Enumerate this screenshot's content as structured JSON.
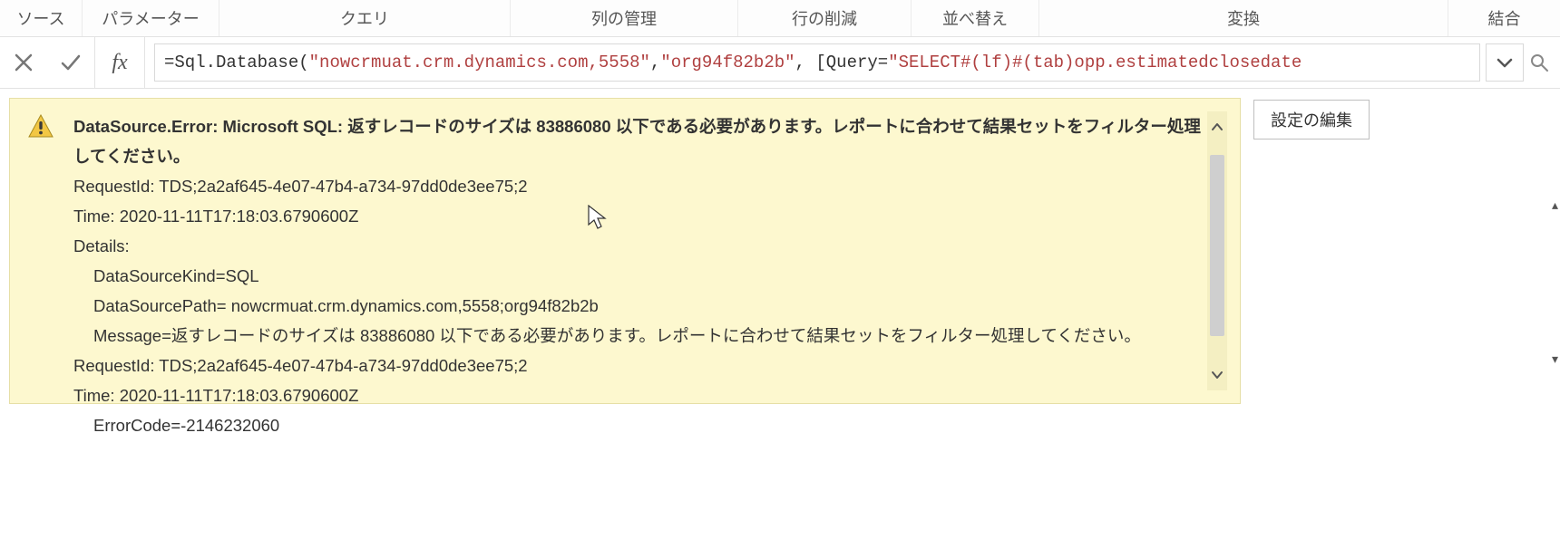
{
  "ribbon": {
    "source": "ソース",
    "param": "パラメーター",
    "query": "クエリ",
    "manage": "列の管理",
    "reduce": "行の削減",
    "sort": "並べ替え",
    "transform": "変換",
    "combine": "結合"
  },
  "formula": {
    "prefix": "= ",
    "fn": "Sql.Database",
    "open": "(",
    "arg1": "\"nowcrmuat.crm.dynamics.com,5558\"",
    "sep1": ", ",
    "arg2": "\"org94f82b2b\"",
    "sep2": ", [",
    "key": "Query",
    "eq": "=",
    "arg3": "\"SELECT#(lf)#(tab)opp.estimatedclosedate"
  },
  "error": {
    "line1": "DataSource.Error: Microsoft SQL: 返すレコードのサイズは 83886080 以下である必要があります。レポートに合わせて結果セットをフィルター処理してください。",
    "line2": "RequestId: TDS;2a2af645-4e07-47b4-a734-97dd0de3ee75;2",
    "line3": "Time: 2020-11-11T17:18:03.6790600Z",
    "line4": "Details:",
    "line5": "DataSourceKind=SQL",
    "line6": "DataSourcePath= nowcrmuat.crm.dynamics.com,5558;org94f82b2b",
    "line7": "Message=返すレコードのサイズは 83886080 以下である必要があります。レポートに合わせて結果セットをフィルター処理してください。",
    "line8": "RequestId: TDS;2a2af645-4e07-47b4-a734-97dd0de3ee75;2",
    "line9": "Time: 2020-11-11T17:18:03.6790600Z",
    "line10": "ErrorCode=-2146232060"
  },
  "buttons": {
    "edit_settings": "設定の編集"
  }
}
